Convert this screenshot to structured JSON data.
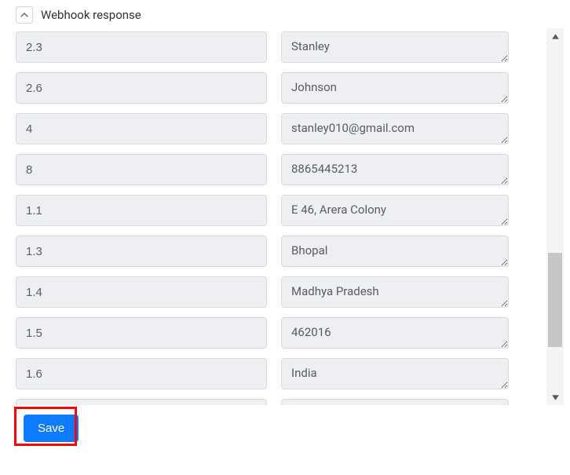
{
  "section": {
    "title": "Webhook response"
  },
  "rows": [
    {
      "key": "2.3",
      "value": "Stanley"
    },
    {
      "key": "2.6",
      "value": "Johnson"
    },
    {
      "key": "4",
      "value": "stanley010@gmail.com"
    },
    {
      "key": "8",
      "value": "8865445213"
    },
    {
      "key": "1.1",
      "value": "E 46, Arera Colony"
    },
    {
      "key": "1.3",
      "value": "Bhopal"
    },
    {
      "key": "1.4",
      "value": "Madhya Pradesh"
    },
    {
      "key": "1.5",
      "value": "462016"
    },
    {
      "key": "1.6",
      "value": "India"
    }
  ],
  "footer": {
    "save_label": "Save"
  }
}
